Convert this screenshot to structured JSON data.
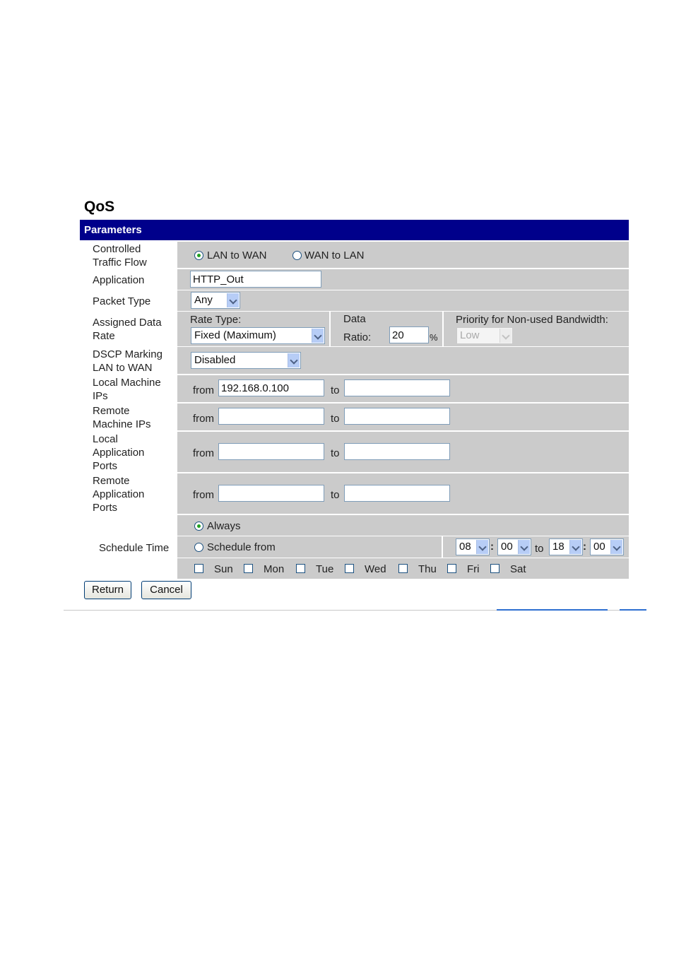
{
  "page_title": "QoS",
  "section_header": "Parameters",
  "labels": {
    "traffic_flow": "Controlled\nTraffic Flow",
    "application": "Application",
    "packet_type": "Packet Type",
    "data_rate": "Assigned Data\nRate",
    "dscp": "DSCP Marking\nLAN to WAN",
    "local_ips": "Local Machine\nIPs",
    "remote_ips": "Remote\nMachine IPs",
    "local_ports": "Local\nApplication\nPorts",
    "remote_ports": "Remote\nApplication\nPorts",
    "schedule": "Schedule Time"
  },
  "traffic_flow": {
    "options": [
      "LAN to WAN",
      "WAN to LAN"
    ],
    "selected": "LAN to WAN"
  },
  "application_value": "HTTP_Out",
  "packet_type_value": "Any",
  "rate": {
    "rate_type_label": "Rate Type:",
    "rate_type_value": "Fixed (Maximum)",
    "data_label": "Data",
    "ratio_label": "Ratio:",
    "ratio_value": "20",
    "percent": "%",
    "priority_label": "Priority for Non-used Bandwidth:",
    "priority_value": "Low"
  },
  "dscp_value": "Disabled",
  "range_from": "from",
  "range_to": "to",
  "local_ips": {
    "from": "192.168.0.100",
    "to": ""
  },
  "remote_ips": {
    "from": "",
    "to": ""
  },
  "local_ports": {
    "from": "",
    "to": ""
  },
  "remote_ports": {
    "from": "",
    "to": ""
  },
  "schedule": {
    "always_label": "Always",
    "from_label": "Schedule from",
    "selected": "Always",
    "start_hour": "08",
    "start_min": "00",
    "to_label": "to",
    "end_hour": "18",
    "end_min": "00",
    "colon": ":",
    "days": [
      "Sun",
      "Mon",
      "Tue",
      "Wed",
      "Thu",
      "Fri",
      "Sat"
    ]
  },
  "buttons": {
    "return": "Return",
    "cancel": "Cancel"
  },
  "colors": {
    "header_bg": "#00008b",
    "cell_bg": "#cbcbcb"
  }
}
